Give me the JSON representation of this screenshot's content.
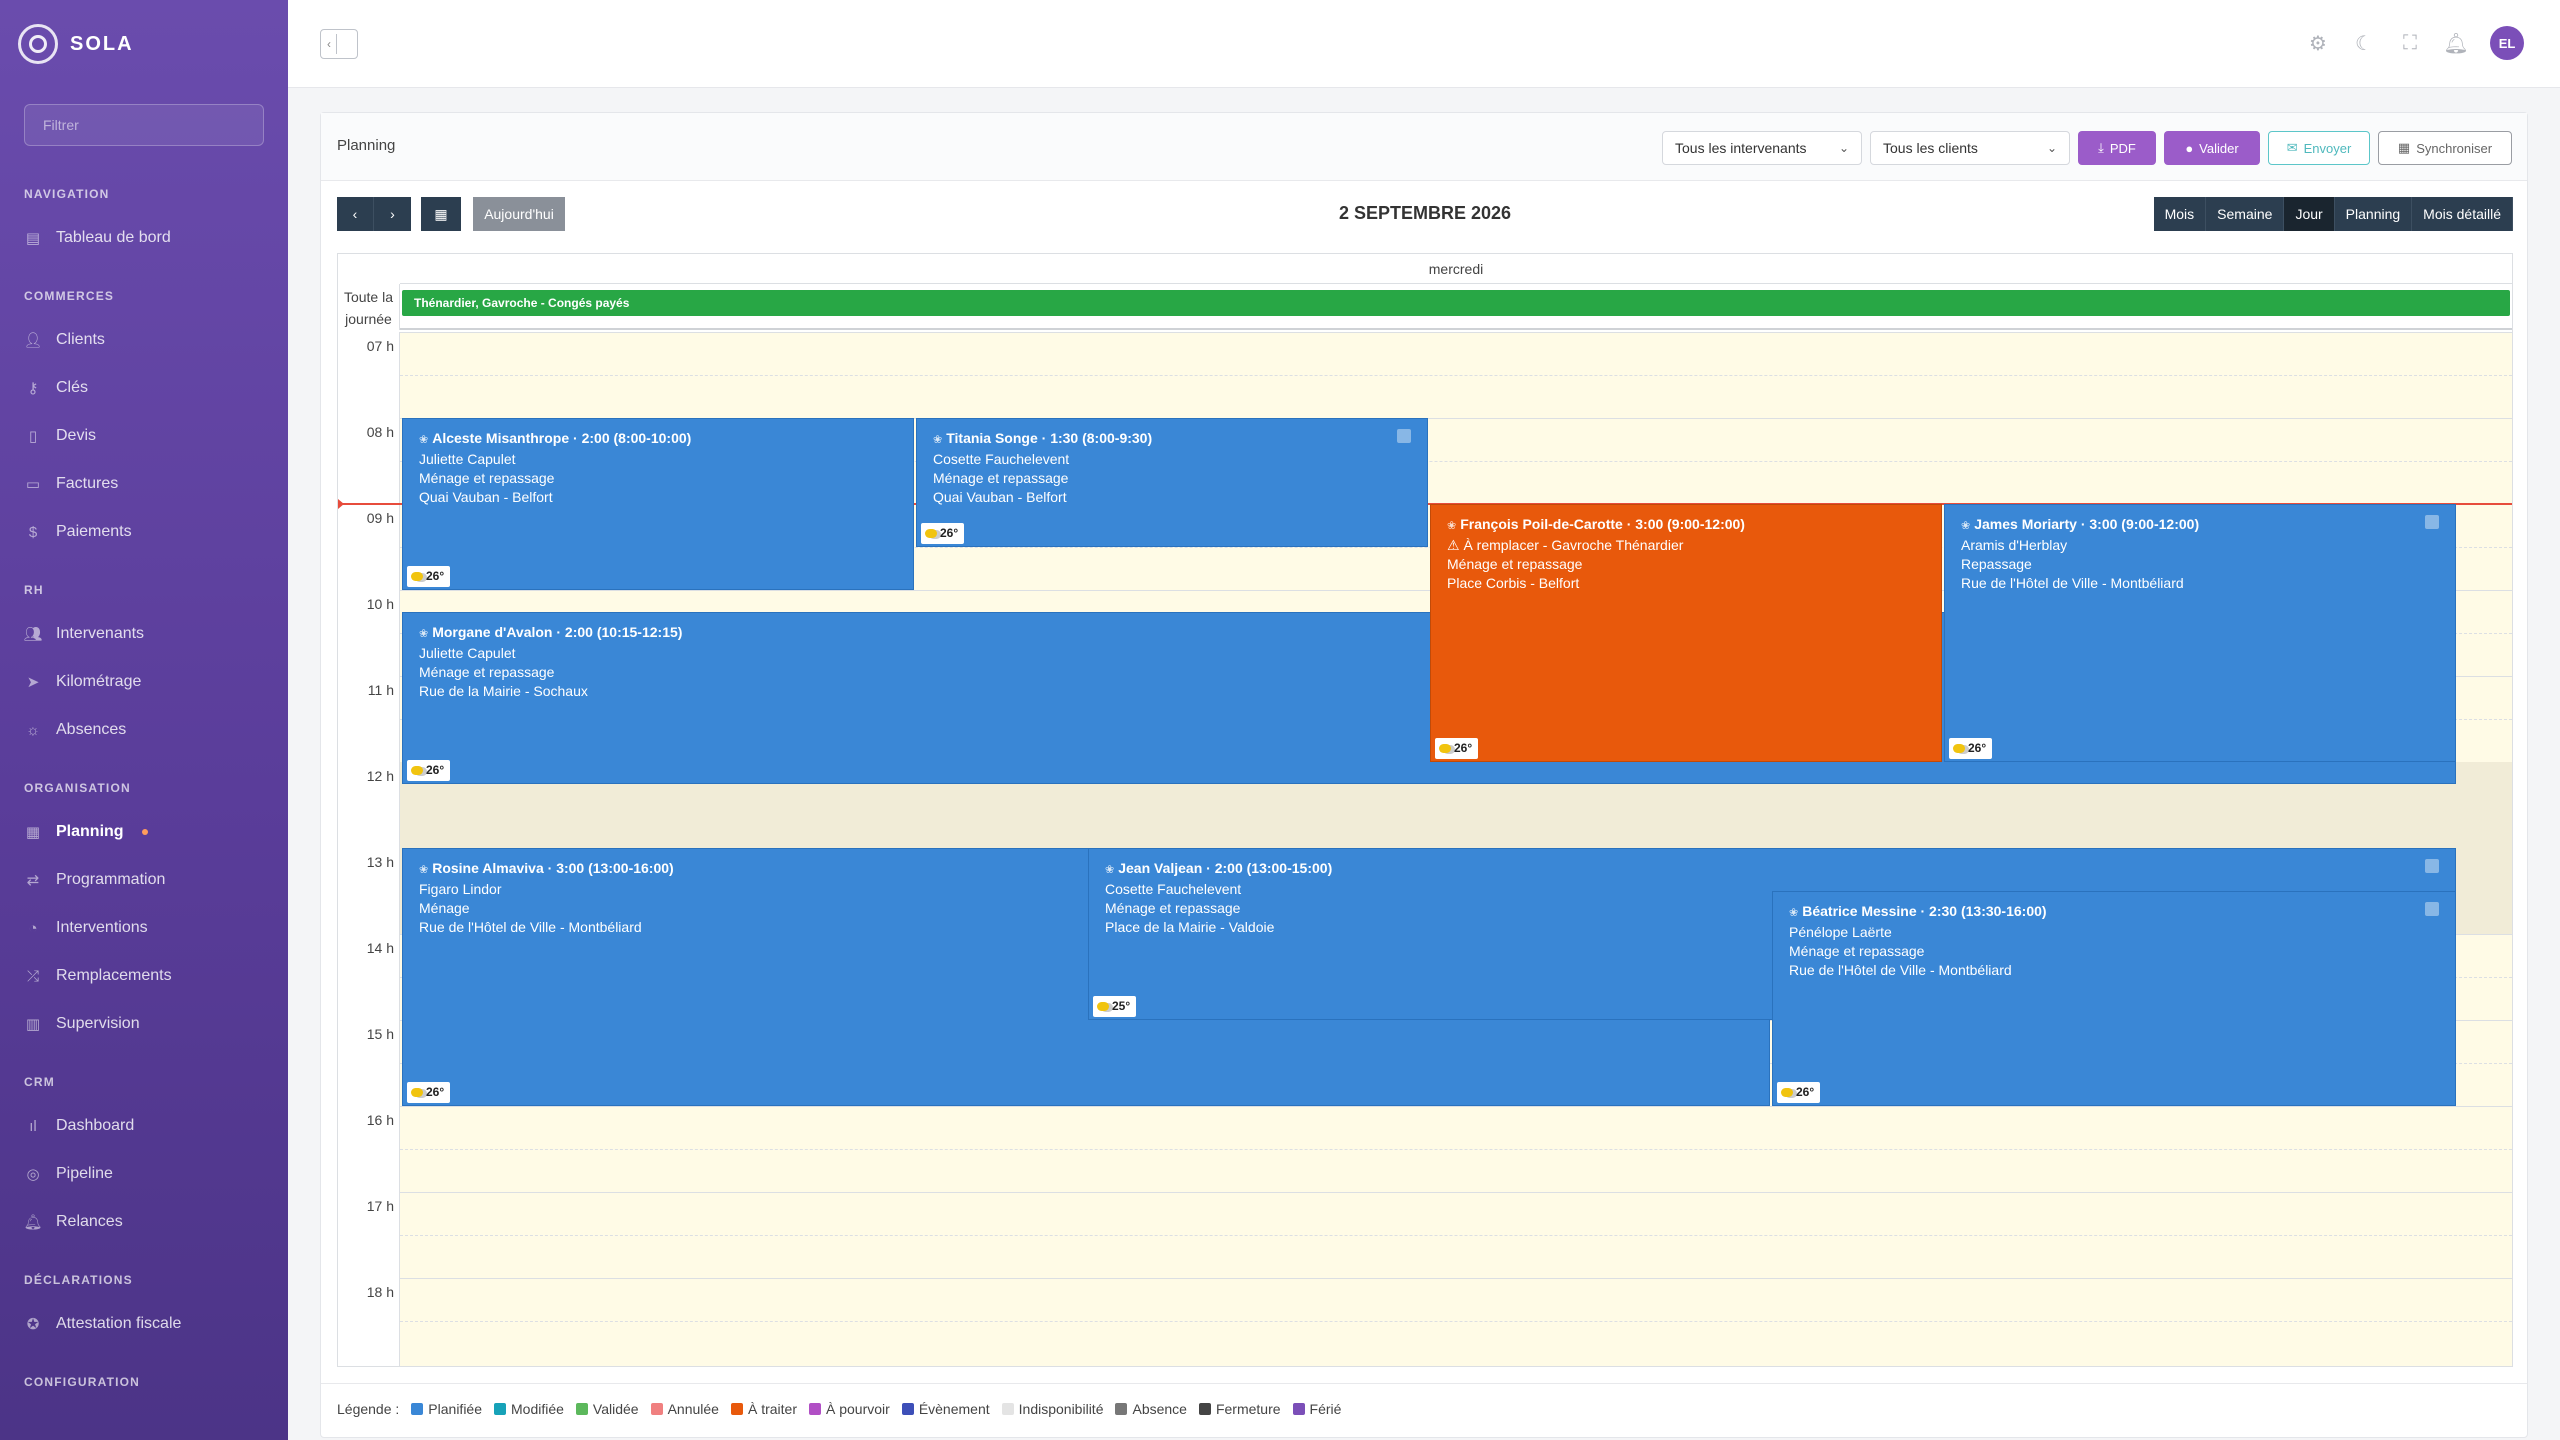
{
  "sidebar": {
    "brand": "SOLA",
    "filter_placeholder": "Filtrer",
    "sections": [
      {
        "title": "NAVIGATION",
        "items": [
          {
            "label": "Tableau de bord",
            "icon": "dashboard-icon"
          }
        ]
      },
      {
        "title": "COMMERCES",
        "items": [
          {
            "label": "Clients",
            "icon": "user-icon"
          },
          {
            "label": "Clés",
            "icon": "key-icon"
          },
          {
            "label": "Devis",
            "icon": "document-icon"
          },
          {
            "label": "Factures",
            "icon": "card-icon"
          },
          {
            "label": "Paiements",
            "icon": "dollar-icon"
          }
        ]
      },
      {
        "title": "RH",
        "items": [
          {
            "label": "Intervenants",
            "icon": "users-icon"
          },
          {
            "label": "Kilométrage",
            "icon": "send-icon"
          },
          {
            "label": "Absences",
            "icon": "sun-icon"
          }
        ]
      },
      {
        "title": "ORGANISATION",
        "items": [
          {
            "label": "Planning",
            "icon": "calendar-icon",
            "active": true
          },
          {
            "label": "Programmation",
            "icon": "repeat-icon"
          },
          {
            "label": "Interventions",
            "icon": "clock-icon"
          },
          {
            "label": "Remplacements",
            "icon": "shuffle-icon"
          },
          {
            "label": "Supervision",
            "icon": "map-icon"
          }
        ]
      },
      {
        "title": "CRM",
        "items": [
          {
            "label": "Dashboard",
            "icon": "bar-chart-icon"
          },
          {
            "label": "Pipeline",
            "icon": "target-icon"
          },
          {
            "label": "Relances",
            "icon": "bell-icon"
          }
        ]
      },
      {
        "title": "DÉCLARATIONS",
        "items": [
          {
            "label": "Attestation fiscale",
            "icon": "award-icon"
          }
        ]
      },
      {
        "title": "CONFIGURATION",
        "items": []
      }
    ]
  },
  "topbar": {
    "avatar": "EL"
  },
  "planning": {
    "title": "Planning",
    "filter_intervenants": "Tous les intervenants",
    "filter_clients": "Tous les clients",
    "btn_pdf": "PDF",
    "btn_valider": "Valider",
    "btn_envoyer": "Envoyer",
    "btn_sync": "Synchroniser",
    "btn_today": "Aujourd'hui",
    "date_title": "2 SEPTEMBRE 2026",
    "views": [
      "Mois",
      "Semaine",
      "Jour",
      "Planning",
      "Mois détaillé"
    ],
    "active_view": "Jour",
    "day_name": "mercredi",
    "allday_label": "Toute la journée",
    "allday_event": "Thénardier, Gavroche - Congés payés",
    "hours": [
      "07 h",
      "08 h",
      "09 h",
      "10 h",
      "11 h",
      "12 h",
      "13 h",
      "14 h",
      "15 h",
      "16 h",
      "17 h",
      "18 h"
    ]
  },
  "events": [
    {
      "title": "Alceste Misanthrope · 2:00 (8:00-10:00)",
      "client": "Juliette Capulet",
      "service": "Ménage et repassage",
      "address": "Quai Vauban - Belfort",
      "weather": "26°",
      "color": "blue",
      "check": false
    },
    {
      "title": "Titania Songe · 1:30 (8:00-9:30)",
      "client": "Cosette Fauchelevent",
      "service": "Ménage et repassage",
      "address": "Quai Vauban - Belfort",
      "weather": "26°",
      "color": "blue",
      "check": true
    },
    {
      "title": "François Poil-de-Carotte · 3:00 (9:00-12:00)",
      "client": "⚠ À remplacer - Gavroche Thénardier",
      "service": "Ménage et repassage",
      "address": "Place Corbis - Belfort",
      "weather": "26°",
      "color": "orange",
      "check": false
    },
    {
      "title": "James Moriarty · 3:00 (9:00-12:00)",
      "client": "Aramis d'Herblay",
      "service": "Repassage",
      "address": "Rue de l'Hôtel de Ville - Montbéliard",
      "weather": "26°",
      "color": "blue",
      "check": true
    },
    {
      "title": "Morgane d'Avalon · 2:00 (10:15-12:15)",
      "client": "Juliette Capulet",
      "service": "Ménage et repassage",
      "address": "Rue de la Mairie - Sochaux",
      "weather": "26°",
      "color": "blue",
      "check": false
    },
    {
      "title": "Rosine Almaviva · 3:00 (13:00-16:00)",
      "client": "Figaro Lindor",
      "service": "Ménage",
      "address": "Rue de l'Hôtel de Ville - Montbéliard",
      "weather": "26°",
      "color": "blue",
      "check": false
    },
    {
      "title": "Jean Valjean · 2:00 (13:00-15:00)",
      "client": "Cosette Fauchelevent",
      "service": "Ménage et repassage",
      "address": "Place de la Mairie - Valdoie",
      "weather": "25°",
      "color": "blue",
      "check": true
    },
    {
      "title": "Béatrice Messine · 2:30 (13:30-16:00)",
      "client": "Pénélope Laërte",
      "service": "Ménage et repassage",
      "address": "Rue de l'Hôtel de Ville - Montbéliard",
      "weather": "26°",
      "color": "blue",
      "check": true
    }
  ],
  "legend": {
    "label": "Légende :",
    "items": [
      {
        "label": "Planifiée",
        "color": "#3a87d6"
      },
      {
        "label": "Modifiée",
        "color": "#17a2b8"
      },
      {
        "label": "Validée",
        "color": "#5cb85c"
      },
      {
        "label": "Annulée",
        "color": "#f08080"
      },
      {
        "label": "À traiter",
        "color": "#e8590c"
      },
      {
        "label": "À pourvoir",
        "color": "#b14fc5"
      },
      {
        "label": "Évènement",
        "color": "#3d4fb8"
      },
      {
        "label": "Indisponibilité",
        "color": "#e4e4e4"
      },
      {
        "label": "Absence",
        "color": "#777777"
      },
      {
        "label": "Fermeture",
        "color": "#444444"
      },
      {
        "label": "Férié",
        "color": "#7b4fb8"
      }
    ]
  }
}
